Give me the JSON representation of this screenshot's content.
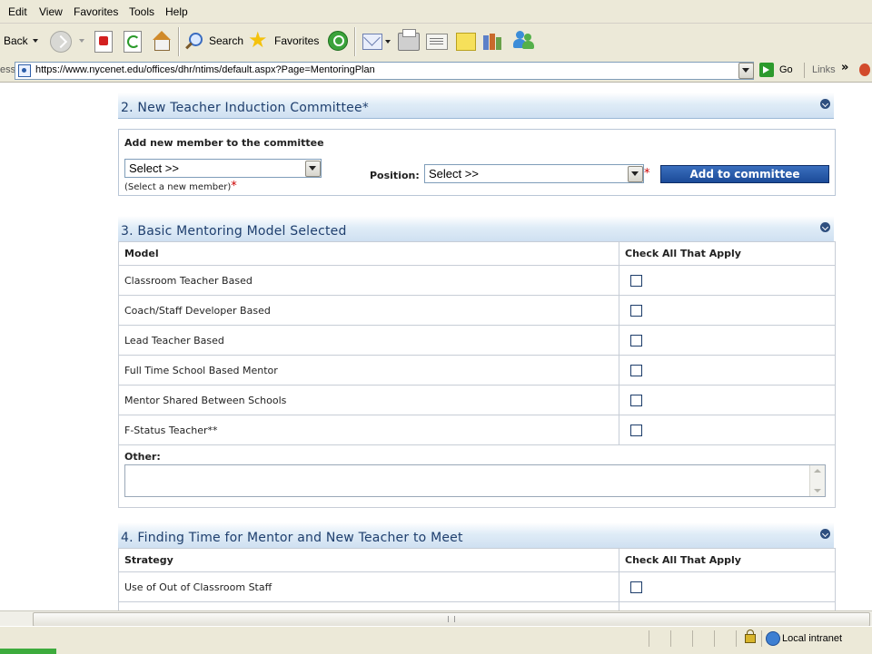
{
  "menu": {
    "items": [
      "Edit",
      "View",
      "Favorites",
      "Tools",
      "Help"
    ]
  },
  "toolbar": {
    "back_label": "Back",
    "search_label": "Search",
    "favorites_label": "Favorites"
  },
  "address": {
    "label": "ess",
    "url": "https://www.nycenet.edu/offices/dhr/ntims/default.aspx?Page=MentoringPlan",
    "go_label": "Go",
    "links_label": "Links",
    "overflow": "»"
  },
  "section2": {
    "title": "2. New Teacher Induction Committee*",
    "add_member_label": "Add new member to the committee",
    "member_select_value": "Select >>",
    "member_hint": "(Select a new member)",
    "required_mark": "*",
    "position_label": "Position:",
    "position_select_value": "Select >>",
    "add_button_label": "Add to committee"
  },
  "section3": {
    "title": "3. Basic Mentoring Model Selected",
    "col_model": "Model",
    "col_check": "Check All That Apply",
    "rows": [
      "Classroom Teacher Based",
      "Coach/Staff Developer Based",
      "Lead Teacher Based",
      "Full Time School Based Mentor",
      "Mentor Shared Between Schools",
      "F-Status Teacher**"
    ],
    "other_label": "Other:"
  },
  "section4": {
    "title": "4. Finding Time for Mentor and New Teacher to Meet",
    "col_strategy": "Strategy",
    "col_check": "Check All That Apply",
    "rows": [
      "Use of Out of Classroom Staff"
    ]
  },
  "status": {
    "zone_label": "Local intranet"
  }
}
